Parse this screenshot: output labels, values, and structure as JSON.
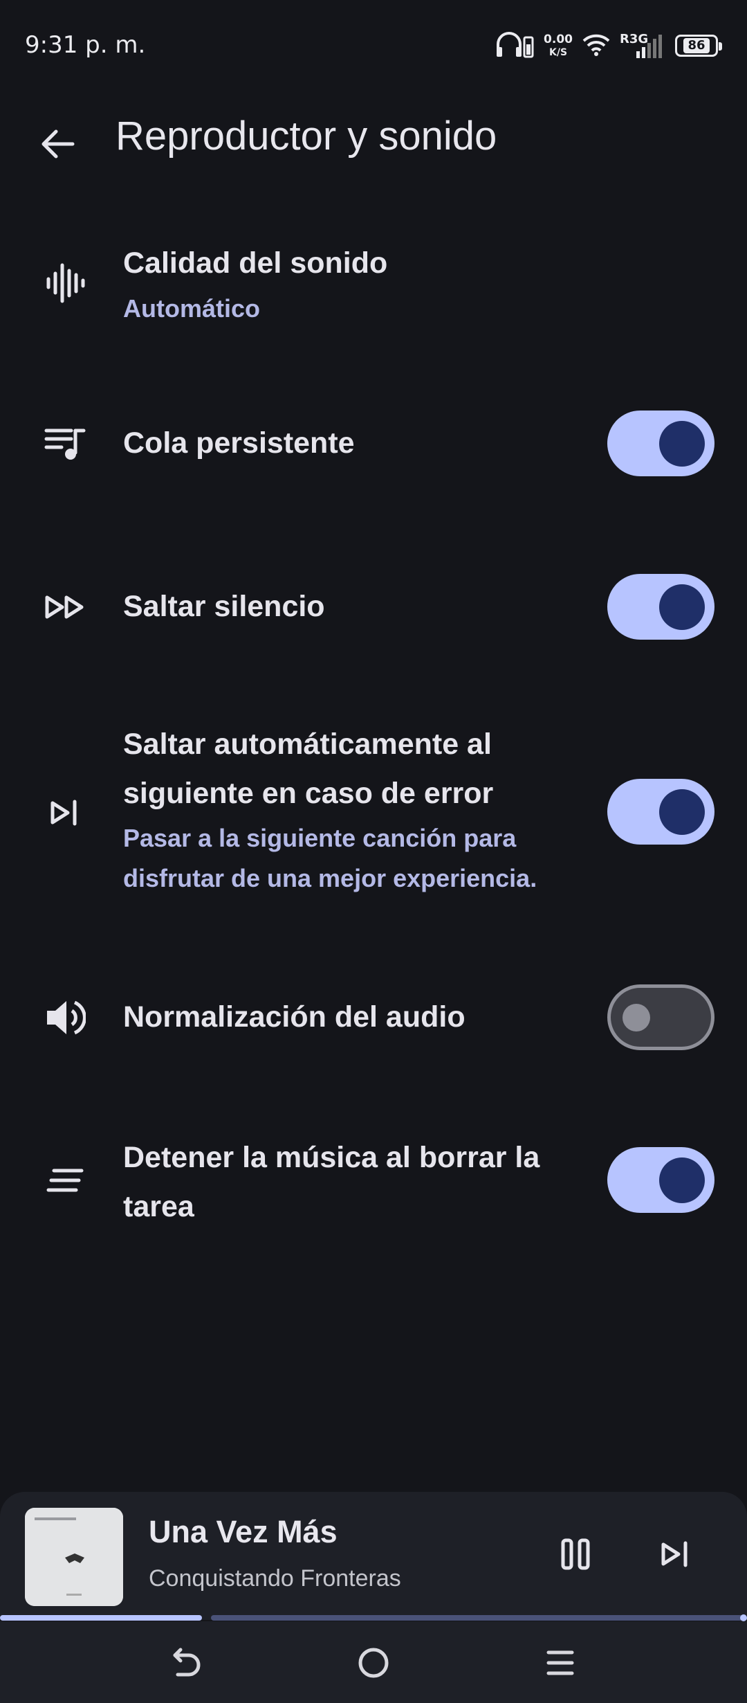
{
  "status_bar": {
    "time": "9:31 p. m.",
    "net_speed_value": "0.00",
    "net_speed_unit": "K/S",
    "signal_label": "R3G",
    "battery_level": "86"
  },
  "header": {
    "title": "Reproductor y sonido"
  },
  "settings": [
    {
      "title": "Calidad del sonido",
      "subtitle": "Automático",
      "icon": "waveform-icon"
    },
    {
      "title": "Cola persistente",
      "icon": "queue-music-icon",
      "toggle": true
    },
    {
      "title": "Saltar silencio",
      "icon": "fast-forward-icon",
      "toggle": true
    },
    {
      "title_line1": "Saltar automáticamente al",
      "title_line2": "siguiente en caso de error",
      "subtitle_line1": "Pasar a la siguiente canción para",
      "subtitle_line2": "disfrutar de una mejor experiencia.",
      "icon": "skip-next-icon",
      "toggle": true
    },
    {
      "title": "Normalización del audio",
      "icon": "volume-icon",
      "toggle": false
    },
    {
      "title_line1": "Detener la música al borrar la",
      "title_line2": "tarea",
      "icon": "clear-all-icon",
      "toggle": true
    }
  ],
  "player": {
    "track_title": "Una Vez Más",
    "artist": "Conquistando Fronteras",
    "progress": 0.27
  },
  "colors": {
    "background": "#14151a",
    "accent": "#b7c4ff",
    "knob": "#1f2f68",
    "subtitle": "#b4b9e6",
    "surface": "#1e2027"
  }
}
